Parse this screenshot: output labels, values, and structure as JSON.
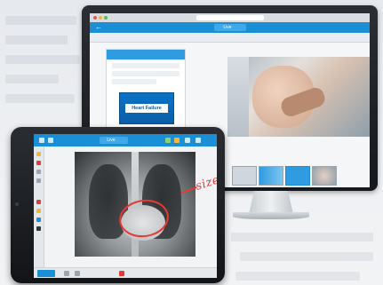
{
  "monitor": {
    "url_text": "",
    "app_title": "Live",
    "app_badge": "",
    "sidepanel_header": "",
    "slide_title": "Heart Failure"
  },
  "tablet": {
    "app_title": "Live",
    "app_badge": "",
    "annotation_text": "size"
  },
  "colors": {
    "accent": "#1b8fd6",
    "badge": "#f5b53b",
    "annotation": "#e53935",
    "slide": "#0b5ea7"
  }
}
